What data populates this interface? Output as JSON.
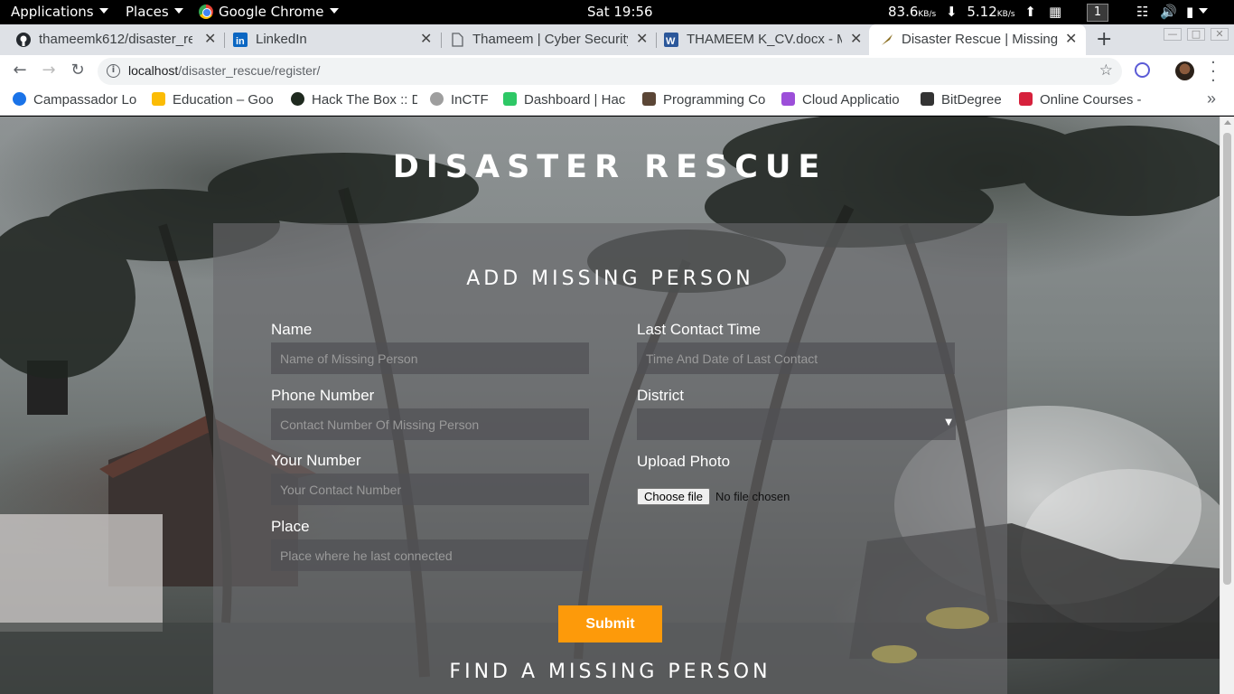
{
  "system_bar": {
    "applications": "Applications",
    "places": "Places",
    "active_app": "Google Chrome",
    "clock": "Sat 19:56",
    "net_down": "83.6",
    "net_down_unit": "KB/s",
    "net_up": "5.12",
    "net_up_unit": "KB/s",
    "workspace": "1"
  },
  "browser": {
    "tabs": [
      {
        "label": "thameemk612/disaster_re",
        "icon": "github-icon"
      },
      {
        "label": "LinkedIn",
        "icon": "linkedin-icon"
      },
      {
        "label": "Thameem | Cyber Security",
        "icon": "document-icon"
      },
      {
        "label": "THAMEEM K_CV.docx - M",
        "icon": "word-icon"
      },
      {
        "label": "Disaster Rescue | Missing",
        "icon": "site-icon",
        "active": true
      }
    ],
    "url_host": "localhost",
    "url_path": "/disaster_rescue/register/",
    "bookmarks": [
      {
        "label": "Campassador Lo",
        "color": "#1a73e8"
      },
      {
        "label": "Education – Goo",
        "color": "#fbbc05"
      },
      {
        "label": "Hack The Box :: D",
        "color": "#1f2a1f"
      },
      {
        "label": "InCTF",
        "color": "#9e9e9e"
      },
      {
        "label": "Dashboard | Hac",
        "color": "#2ec866"
      },
      {
        "label": "Programming Co",
        "color": "#5b4636"
      },
      {
        "label": "Cloud Applicatio",
        "color": "#9c4fd9"
      },
      {
        "label": "BitDegree",
        "color": "#333333"
      },
      {
        "label": "Online Courses -",
        "color": "#d6213c"
      }
    ]
  },
  "page": {
    "site_title": "DISASTER RESCUE",
    "form_title": "ADD MISSING PERSON",
    "name_label": "Name",
    "name_placeholder": "Name of Missing Person",
    "phone_label": "Phone Number",
    "phone_placeholder": "Contact Number Of Missing Person",
    "your_number_label": "Your Number",
    "your_number_placeholder": "Your Contact Number",
    "place_label": "Place",
    "place_placeholder": "Place where he last connected",
    "last_contact_label": "Last Contact Time",
    "last_contact_placeholder": "Time And Date of Last Contact",
    "district_label": "District",
    "district_value": "",
    "upload_label": "Upload Photo",
    "choose_file": "Choose file",
    "no_file": "No file chosen",
    "submit": "Submit",
    "find_title": "FIND A MISSING PERSON"
  },
  "colors": {
    "accent": "#fd9a0a",
    "panel": "#69696c"
  }
}
